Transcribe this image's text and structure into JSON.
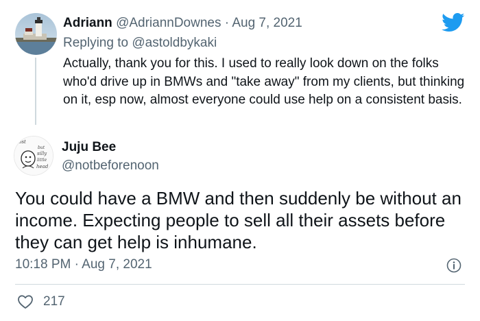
{
  "reply_tweet": {
    "author_name": "Adriann",
    "author_handle": "@AdriannDownes",
    "separator": "·",
    "date": "Aug 7, 2021",
    "replying_to_prefix": "Replying to",
    "replying_to_handle": "@astoldbykaki",
    "text": "Actually, thank you for this. I used to really look down on the folks who'd drive up in BMWs and \"take away\" from my clients, but thinking on it, esp now, almost everyone could use help on a consistent basis.",
    "avatar_icon": "lighthouse-avatar"
  },
  "main_tweet": {
    "author_name": "Juju Bee",
    "author_handle": "@notbeforenoon",
    "text": "You could have a BMW and then suddenly be without an income. Expecting people to sell all their assets before they can get help is inhumane.",
    "time": "10:18 PM",
    "separator": "·",
    "date": "Aug 7, 2021",
    "likes": "217",
    "avatar_icon": "doodle-face-avatar",
    "avatar_text": [
      "lost",
      "but",
      "silly",
      "little",
      "head"
    ]
  },
  "icons": {
    "brand": "twitter-bird-icon",
    "info": "info-icon",
    "like": "heart-icon"
  },
  "colors": {
    "twitter_blue": "#1d9bf0",
    "text_primary": "#0f1419",
    "text_secondary": "#536471",
    "divider": "#cfd9de"
  }
}
